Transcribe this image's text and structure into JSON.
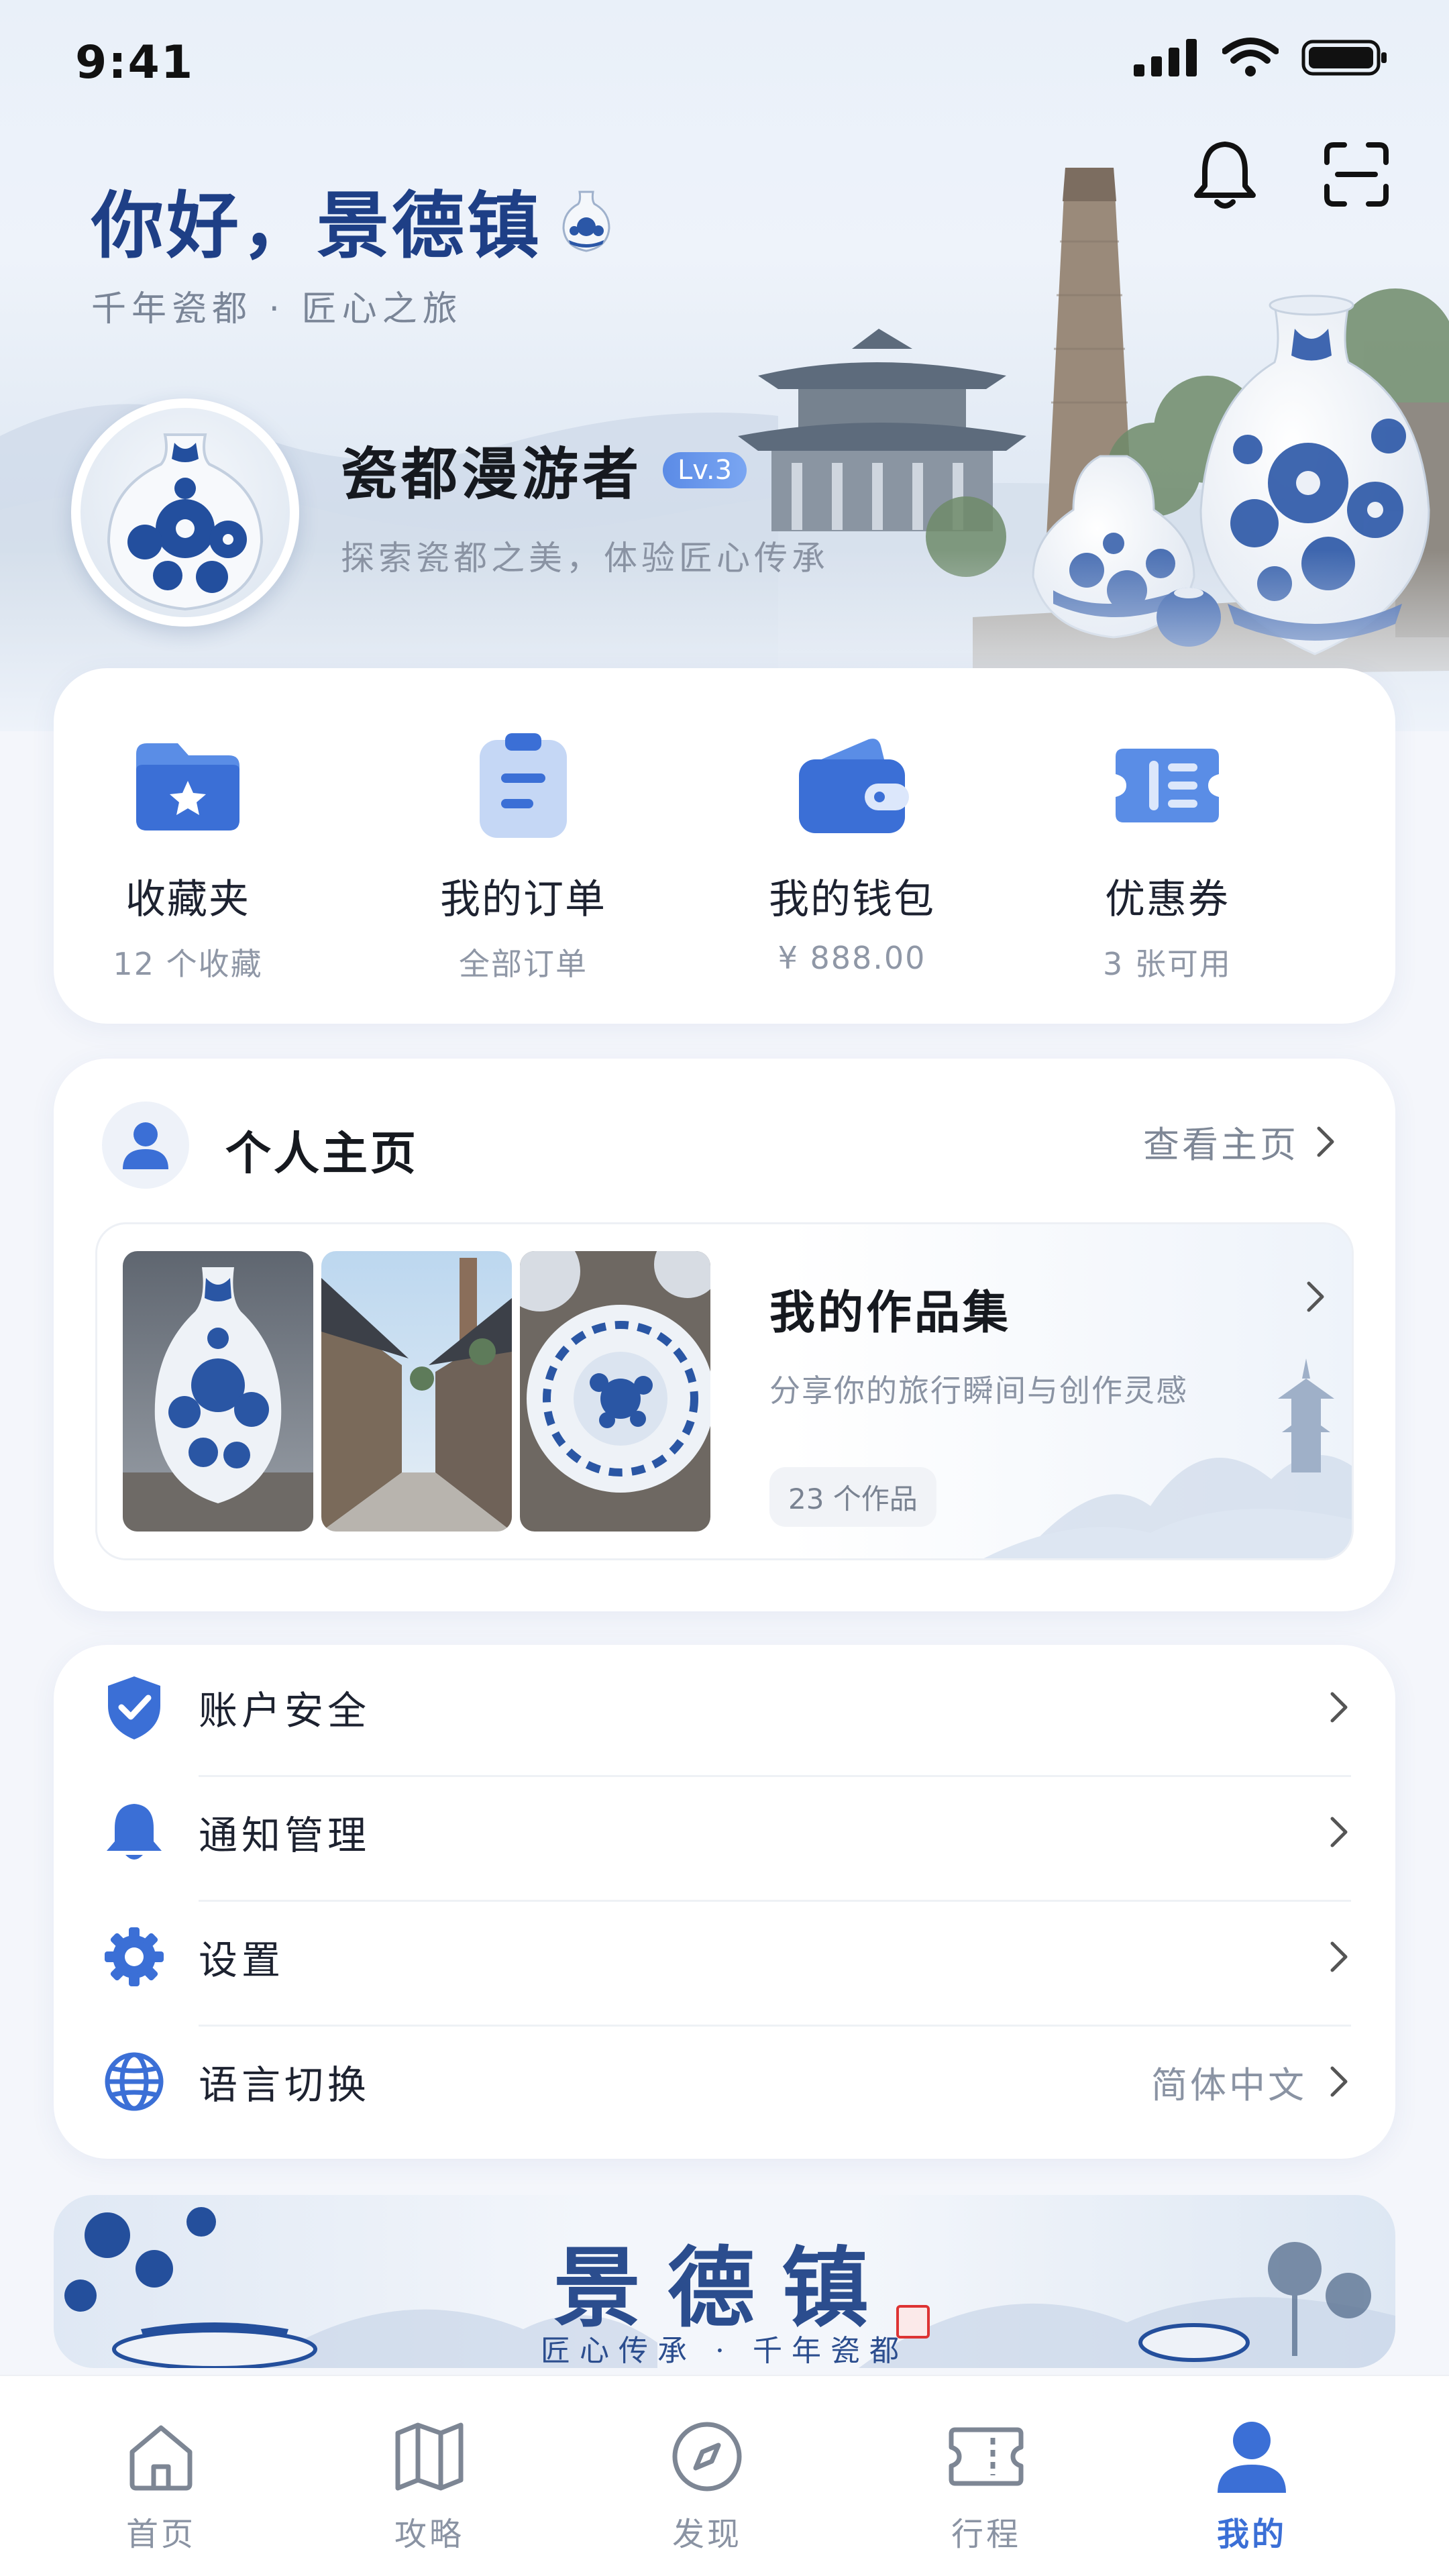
{
  "status_bar": {
    "time": "9:41"
  },
  "header": {
    "greeting": "你好，景德镇",
    "subtitle": "千年瓷都 · 匠心之旅",
    "icons": [
      "bell-icon",
      "scan-icon"
    ]
  },
  "user": {
    "name": "瓷都漫游者",
    "level": "Lv.3",
    "motto": "探索瓷都之美，体验匠心传承"
  },
  "quick_actions": [
    {
      "icon": "folder-star-icon",
      "label": "收藏夹",
      "sub": "12 个收藏"
    },
    {
      "icon": "clipboard-icon",
      "label": "我的订单",
      "sub": "全部订单"
    },
    {
      "icon": "wallet-icon",
      "label": "我的钱包",
      "sub": "¥ 888.00"
    },
    {
      "icon": "coupon-icon",
      "label": "优惠券",
      "sub": "3 张可用"
    }
  ],
  "profile": {
    "title": "个人主页",
    "link": "查看主页",
    "works": {
      "title": "我的作品集",
      "desc": "分享你的旅行瞬间与创作灵感",
      "count": "23 个作品"
    }
  },
  "menu": [
    {
      "icon": "shield-check-icon",
      "label": "账户安全",
      "value": ""
    },
    {
      "icon": "bell-icon",
      "label": "通知管理",
      "value": ""
    },
    {
      "icon": "gear-icon",
      "label": "设置",
      "value": ""
    },
    {
      "icon": "globe-icon",
      "label": "语言切换",
      "value": "简体中文"
    }
  ],
  "banner": {
    "title": "景德镇",
    "subtitle": "匠心传承 · 千年瓷都"
  },
  "tabs": [
    {
      "icon": "home-icon",
      "label": "首页",
      "active": false
    },
    {
      "icon": "map-icon",
      "label": "攻略",
      "active": false
    },
    {
      "icon": "compass-icon",
      "label": "发现",
      "active": false
    },
    {
      "icon": "ticket-icon",
      "label": "行程",
      "active": false
    },
    {
      "icon": "user-icon",
      "label": "我的",
      "active": true
    }
  ],
  "colors": {
    "accent": "#3b6fd6",
    "porcelain_blue": "#2b4d8e",
    "title_blue": "#1e3f86"
  }
}
